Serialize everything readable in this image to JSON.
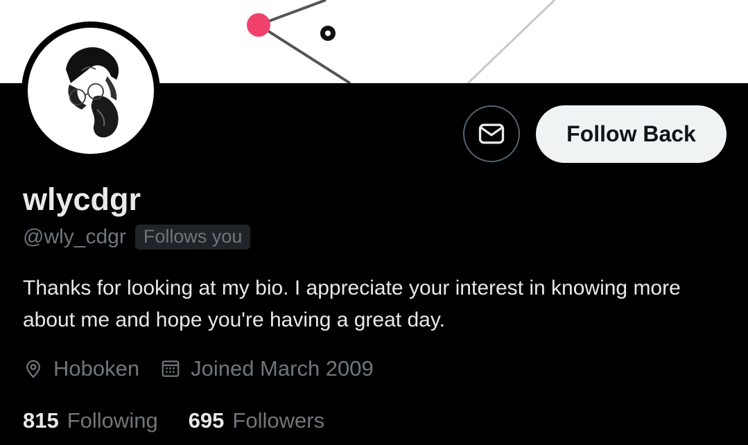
{
  "profile": {
    "display_name": "wlycdgr",
    "handle": "@wly_cdgr",
    "follows_you_badge": "Follows you",
    "bio": "Thanks for looking at my bio. I appreciate your interest in knowing more about me and hope you're having a great day.",
    "location": "Hoboken",
    "joined": "Joined March 2009",
    "following_count": "815",
    "following_label": "Following",
    "followers_count": "695",
    "followers_label": "Followers"
  },
  "actions": {
    "follow_back_label": "Follow Back",
    "message_icon": "envelope-icon"
  },
  "icons": {
    "location": "location-pin-icon",
    "calendar": "calendar-icon"
  },
  "colors": {
    "background": "#000000",
    "banner": "#ffffff",
    "primary_text": "#e7e9ea",
    "secondary_text": "#71767b",
    "badge_bg": "#202327",
    "button_bg": "#eff3f4",
    "banner_dot": "#f0416c"
  }
}
